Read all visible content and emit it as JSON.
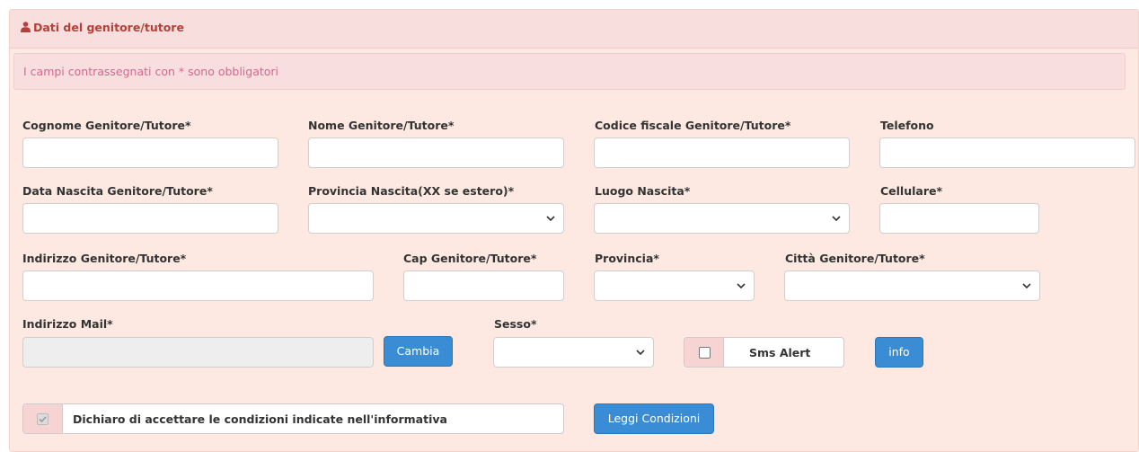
{
  "panel": {
    "title": "Dati del genitore/tutore",
    "required_notice": "I campi contrassegnati con * sono obbligatori"
  },
  "fields": {
    "cognome": {
      "label": "Cognome Genitore/Tutore*",
      "value": ""
    },
    "nome": {
      "label": "Nome Genitore/Tutore*",
      "value": ""
    },
    "codice_fiscale": {
      "label": "Codice fiscale Genitore/Tutore*",
      "value": ""
    },
    "telefono": {
      "label": "Telefono",
      "value": ""
    },
    "data_nascita": {
      "label": "Data Nascita Genitore/Tutore*",
      "value": ""
    },
    "provincia_nascita": {
      "label": "Provincia Nascita(XX se estero)*",
      "selected": ""
    },
    "luogo_nascita": {
      "label": "Luogo Nascita*",
      "selected": ""
    },
    "cellulare": {
      "label": "Cellulare*",
      "value": ""
    },
    "indirizzo": {
      "label": "Indirizzo Genitore/Tutore*",
      "value": ""
    },
    "cap": {
      "label": "Cap Genitore/Tutore*",
      "value": ""
    },
    "provincia": {
      "label": "Provincia*",
      "selected": ""
    },
    "citta": {
      "label": "Città Genitore/Tutore*",
      "selected": ""
    },
    "email": {
      "label": "Indirizzo Mail*",
      "value": ""
    },
    "sesso": {
      "label": "Sesso*",
      "selected": ""
    }
  },
  "buttons": {
    "cambia": "Cambia",
    "info": "info",
    "leggi_condizioni": "Leggi Condizioni"
  },
  "sms_alert": {
    "label": "Sms Alert",
    "checked": false
  },
  "conditions": {
    "label": "Dichiaro di accettare le condizioni indicate nell'informativa",
    "checked": true
  },
  "colors": {
    "panel_bg": "#fde9e2",
    "header_text": "#b5403b",
    "notice_text": "#d06a8c",
    "button_primary": "#3a8dd5"
  },
  "icons": {
    "header": "user-icon",
    "select": "chevron-down-icon"
  }
}
